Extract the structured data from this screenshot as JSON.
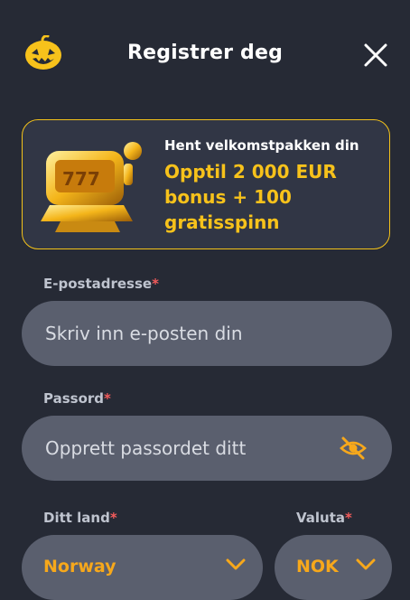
{
  "header": {
    "title": "Registrer deg",
    "logo_icon": "pumpkin-icon",
    "close_icon": "close-icon"
  },
  "promo": {
    "subtitle": "Hent velkomstpakken din",
    "offer": "Opptil 2 000 EUR bonus + 100 gratisspinn",
    "image_icon": "slot-machine-icon",
    "accent_color": "#f7c21b"
  },
  "form": {
    "email": {
      "label": "E-postadresse",
      "required_mark": "*",
      "placeholder": "Skriv inn e-posten din"
    },
    "password": {
      "label": "Passord",
      "required_mark": "*",
      "placeholder": "Opprett passordet ditt",
      "toggle_icon": "eye-off-icon"
    },
    "country": {
      "label": "Ditt land",
      "required_mark": "*",
      "value": "Norway"
    },
    "currency": {
      "label": "Valuta",
      "required_mark": "*",
      "value": "NOK"
    }
  },
  "colors": {
    "background": "#262a35",
    "input_bg": "#5a5f6e",
    "accent": "#f7a81b",
    "required": "#f35b5b"
  }
}
